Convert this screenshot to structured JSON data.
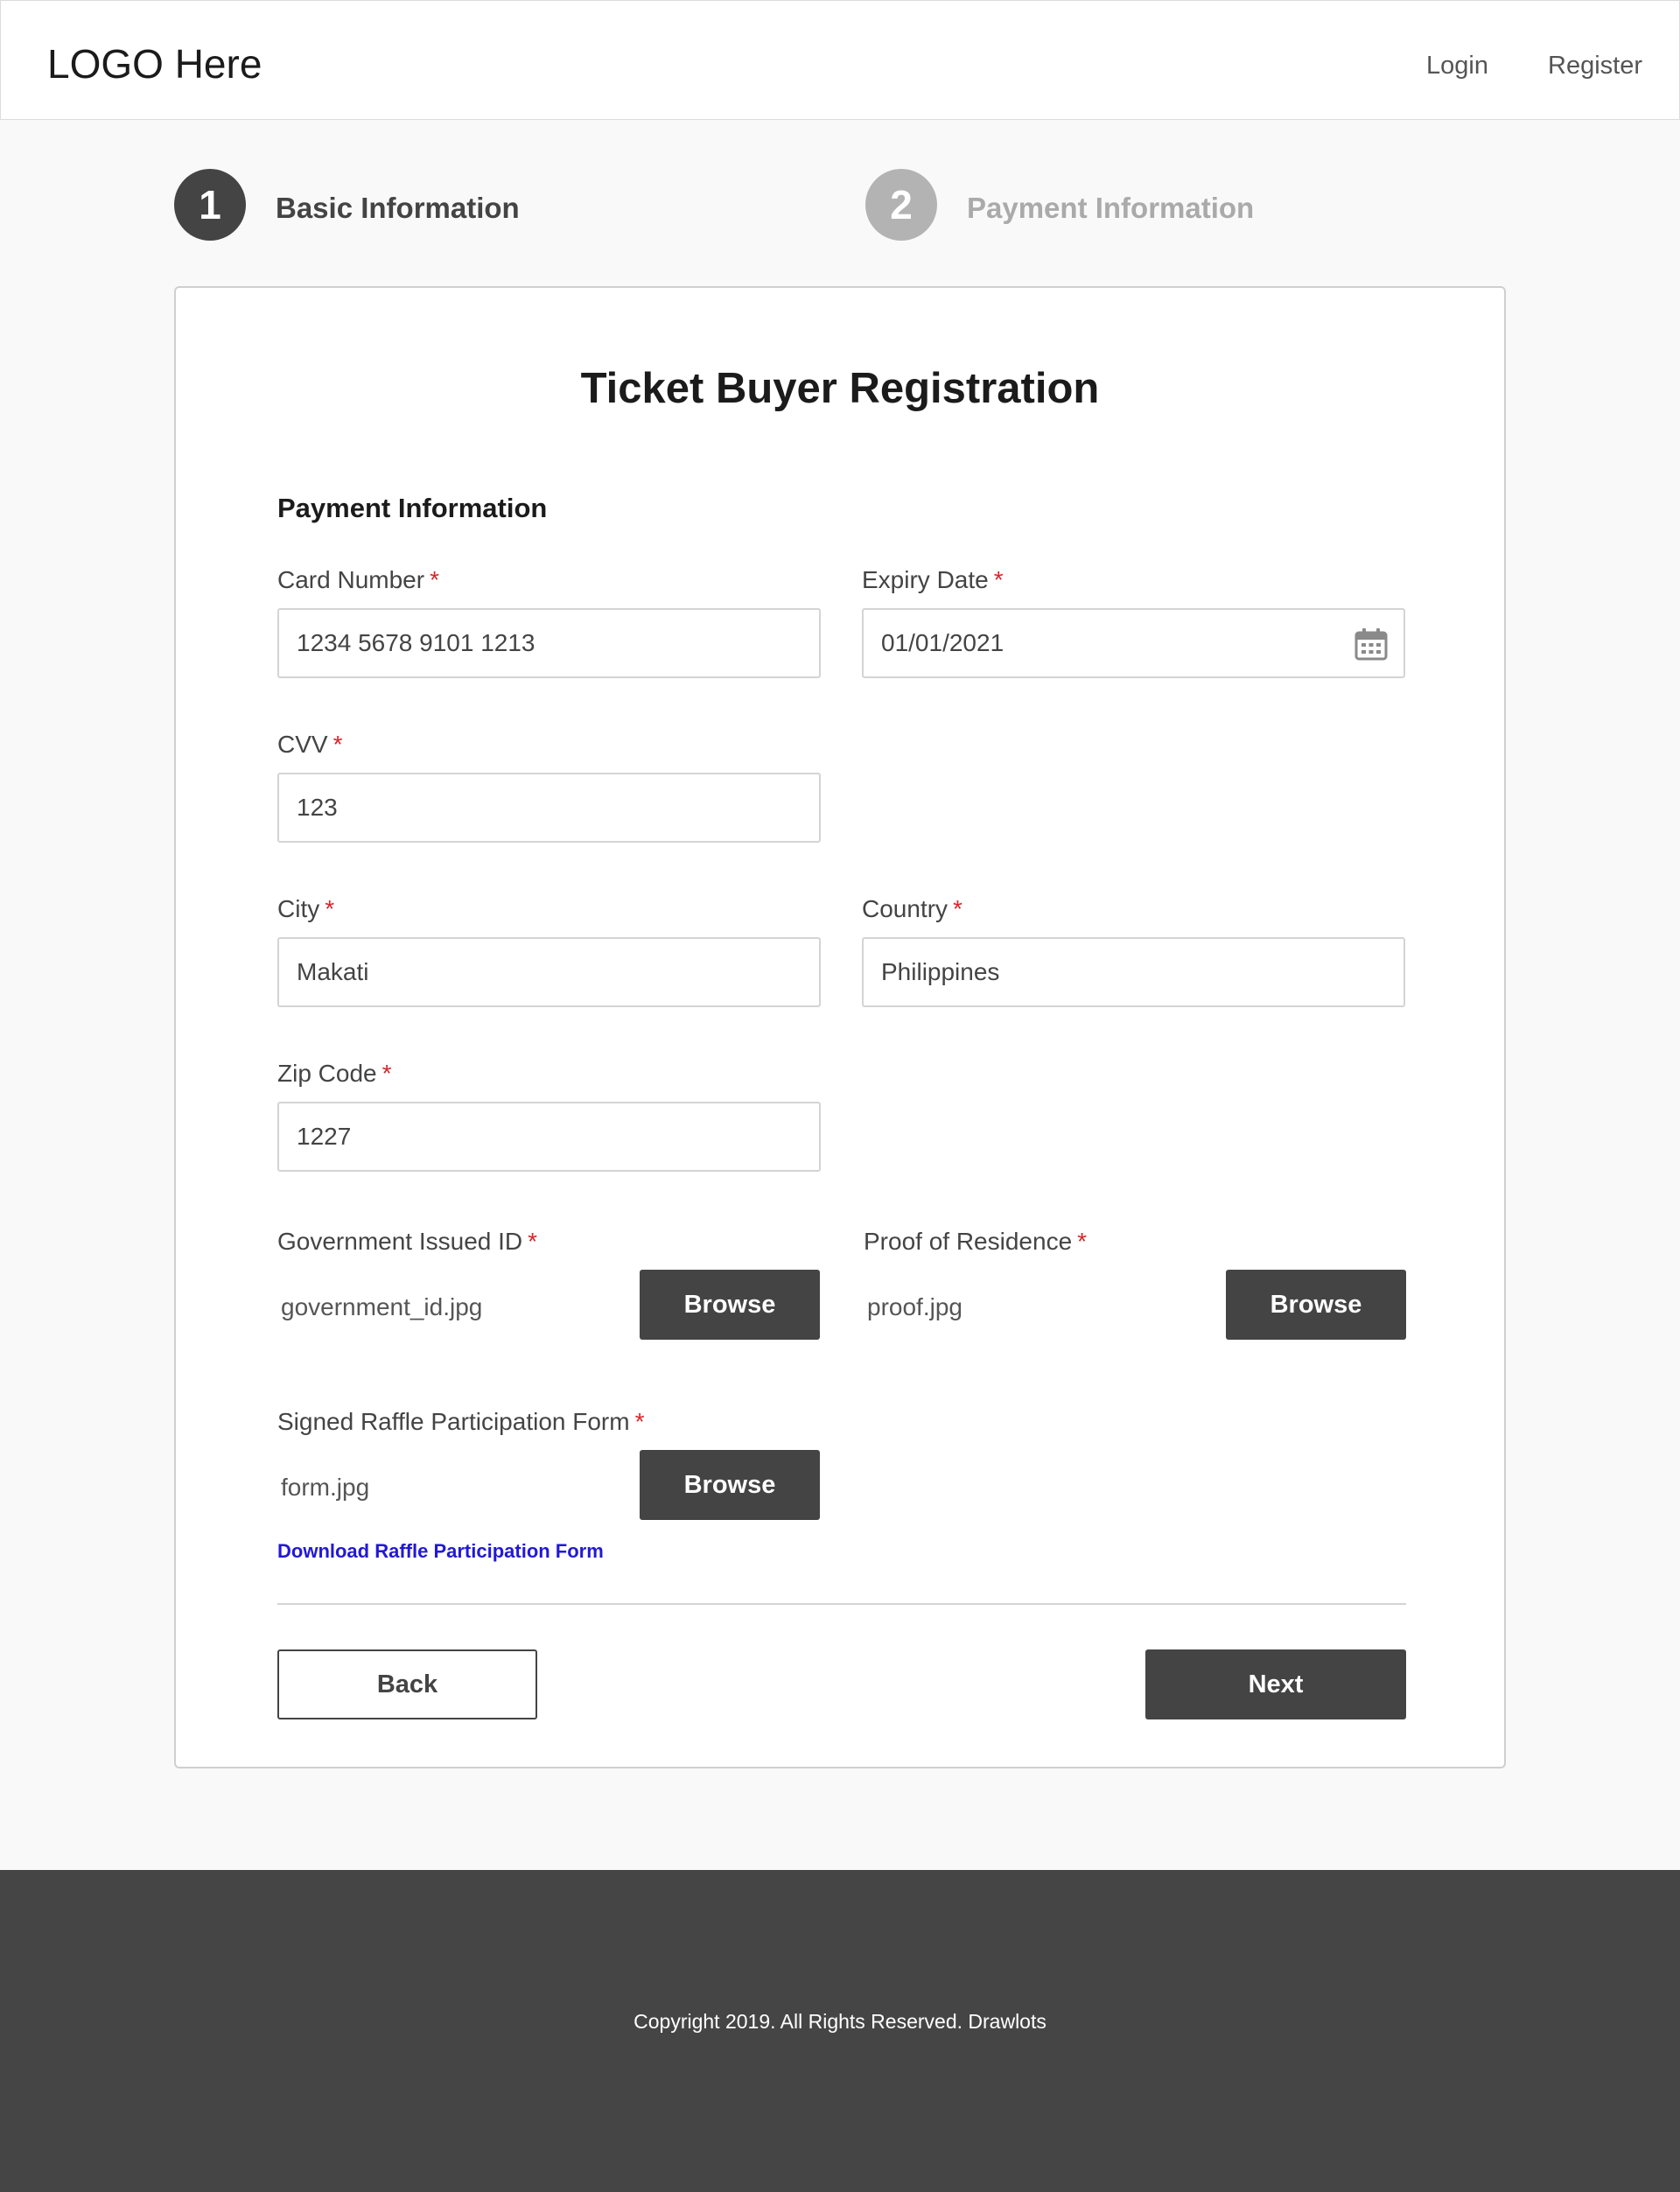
{
  "header": {
    "logo": "LOGO Here",
    "nav": {
      "login": "Login",
      "register": "Register"
    }
  },
  "stepper": {
    "steps": [
      {
        "number": "1",
        "label": "Basic Information",
        "state": "active"
      },
      {
        "number": "2",
        "label": "Payment Information",
        "state": "inactive"
      }
    ]
  },
  "form": {
    "title": "Ticket Buyer Registration",
    "section_title": "Payment Information",
    "required_marker": "*",
    "fields": {
      "card_number": {
        "label": "Card Number",
        "value": "1234 5678 9101 1213"
      },
      "expiry_date": {
        "label": "Expiry Date",
        "value": "01/01/2021",
        "icon": "calendar-icon"
      },
      "cvv": {
        "label": "CVV",
        "value": "123"
      },
      "city": {
        "label": "City",
        "value": "Makati"
      },
      "country": {
        "label": "Country",
        "value": "Philippines"
      },
      "zip_code": {
        "label": "Zip Code",
        "value": "1227"
      }
    },
    "uploads": {
      "government_id": {
        "label": "Government Issued ID",
        "file": "government_id.jpg",
        "button": "Browse"
      },
      "proof_of_residence": {
        "label": "Proof of Residence",
        "file": "proof.jpg",
        "button": "Browse"
      },
      "raffle_form": {
        "label": "Signed Raffle Participation Form",
        "file": "form.jpg",
        "button": "Browse"
      }
    },
    "download_link": "Download Raffle Participation Form",
    "back_label": "Back",
    "next_label": "Next"
  },
  "footer": {
    "copyright": "Copyright 2019. All Rights Reserved. Drawlots"
  },
  "colors": {
    "dark": "#444444",
    "inactive_step": "#b3b3b3",
    "required": "#d9252b",
    "link": "#2218d6",
    "footer_bg": "#454545"
  }
}
